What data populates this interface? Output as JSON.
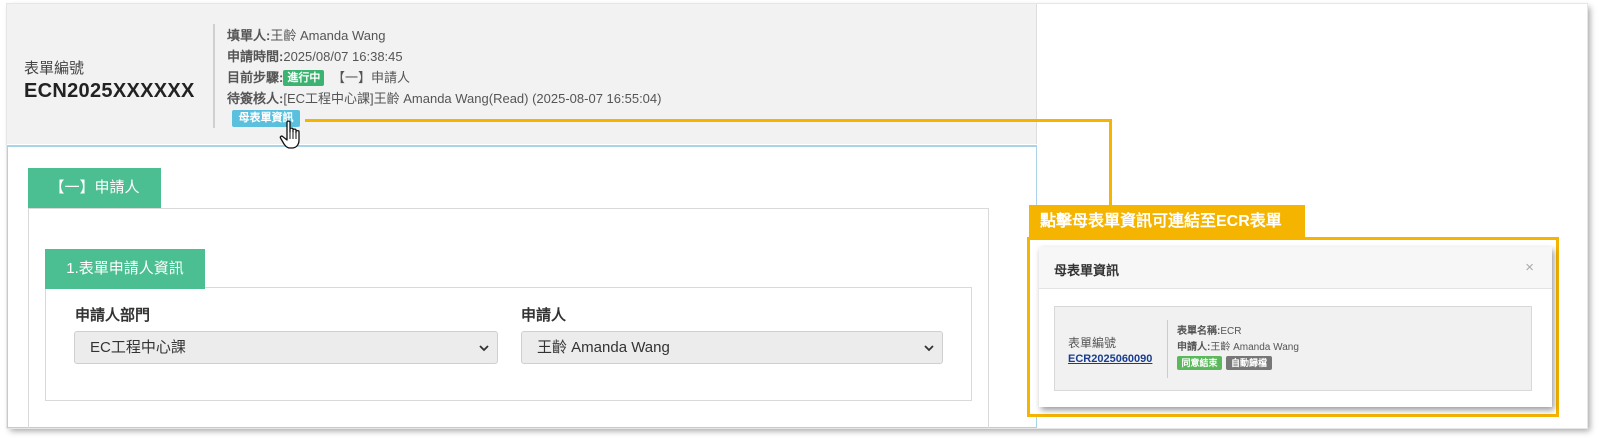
{
  "header": {
    "form_no_label": "表單編號",
    "form_no_value": "ECN2025XXXXXX",
    "filler_label": "填單人:",
    "filler_value": "王齡 Amanda Wang",
    "apply_time_label": "申請時間:",
    "apply_time_value": "2025/08/07 16:38:45",
    "step_label": "目前步驟:",
    "step_badge": "進行中",
    "step_value": "【一】申請人",
    "pending_label": "待簽核人:",
    "pending_value": "[EC工程中心課]王齡 Amanda Wang(Read) (2025-08-07 16:55:04)",
    "parent_button": "母表單資訊"
  },
  "form": {
    "section_tab": "【一】申請人",
    "subsection_tab": "1.表單申請人資訊",
    "dept_label": "申請人部門",
    "dept_value": "EC工程中心課",
    "applicant_label": "申請人",
    "applicant_value": "王齡 Amanda Wang"
  },
  "callout": {
    "title": "點擊母表單資訊可連結至ECR表單"
  },
  "modal": {
    "title": "母表單資訊",
    "close": "×",
    "form_no_label": "表單編號",
    "form_no_link": "ECR2025060090",
    "form_name_label": "表單名稱:",
    "form_name_value": "ECR",
    "applicant_label": "申請人:",
    "applicant_value": "王齡 Amanda Wang",
    "badge_agree": "同意結束",
    "badge_auto": "自動歸檔"
  },
  "colors": {
    "accent_green": "#4cbf92",
    "info_blue": "#5bc0de",
    "callout_yellow": "#f5b400",
    "badge_progress": "#3cb371",
    "badge_agree": "#5cb85c",
    "badge_auto": "#777777"
  },
  "icons": [
    "hand-pointer-icon",
    "chevron-down-icon",
    "close-icon"
  ]
}
